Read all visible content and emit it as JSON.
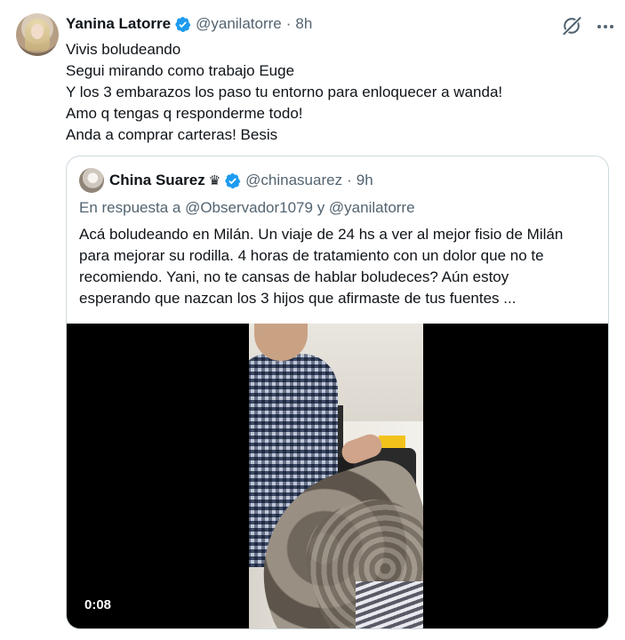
{
  "tweet": {
    "author_name": "Yanina Latorre",
    "handle": "@yanilatorre",
    "separator": "·",
    "time": "8h",
    "lines": [
      "Vivis boludeando",
      "Segui mirando como trabajo Euge",
      "Y los 3 embarazos los paso tu entorno para enloquecer a wanda!",
      "Amo q tengas q responderme todo!",
      "Anda a comprar carteras! Besis"
    ],
    "icons": {
      "avatar": "profile-photo",
      "verified": "verified-badge-icon",
      "grok": "grok-icon",
      "more": "more-icon"
    }
  },
  "quote": {
    "author_name": "China Suarez",
    "crown": "♛",
    "handle": "@chinasuarez",
    "separator": "·",
    "time": "9h",
    "reply_to": "En respuesta a @Observador1079 y @yanilatorre",
    "lines": [
      "Acá boludeando en Milán. Un viaje de 24 hs a ver al mejor fisio de Milán",
      "para mejorar su rodilla. 4 horas de tratamiento con un dolor que no te",
      "recomiendo. Yani, no te cansas de hablar boludeces? Aún estoy",
      "esperando que nazcan los 3 hijos que afirmaste de tus fuentes ..."
    ],
    "video": {
      "duration": "0:08"
    }
  },
  "colors": {
    "text": "#0f1419",
    "secondary": "#536471",
    "verified": "#1d9bf0",
    "border": "#cfd9de"
  }
}
